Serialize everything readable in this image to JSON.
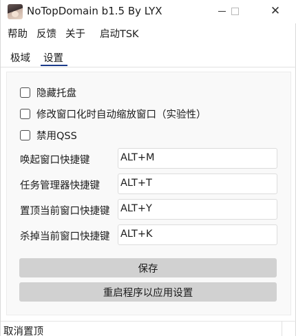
{
  "window": {
    "title": "NoTopDomain b1.5 By LYX",
    "controls": {
      "minimize_icon": "minimize-icon",
      "maximize_icon": "maximize-icon",
      "close_icon": "close-icon",
      "close_glyph": "✕"
    }
  },
  "menubar": {
    "items": [
      {
        "label": "帮助"
      },
      {
        "label": "反馈"
      },
      {
        "label": "关于"
      },
      {
        "label": "启动TSK"
      }
    ]
  },
  "tabs": {
    "items": [
      {
        "label": "极域",
        "active": false
      },
      {
        "label": "设置",
        "active": true
      }
    ],
    "active_color": "#1a3a8a"
  },
  "settings": {
    "checkboxes": [
      {
        "label": "隐藏托盘",
        "checked": false
      },
      {
        "label": "修改窗口化时自动缩放窗口（实验性）",
        "checked": false
      },
      {
        "label": "禁用QSS",
        "checked": false
      }
    ],
    "hotkeys": [
      {
        "label": "唤起窗口快捷键",
        "value": "ALT+M"
      },
      {
        "label": "任务管理器快捷键",
        "value": "ALT+T"
      },
      {
        "label": "置顶当前窗口快捷键",
        "value": "ALT+Y"
      },
      {
        "label": "杀掉当前窗口快捷键",
        "value": "ALT+K"
      }
    ],
    "save_label": "保存",
    "restart_label": "重启程序以应用设置"
  },
  "statusbar": {
    "text": "取消置顶"
  },
  "colors": {
    "button_bg": "#d1d1d1",
    "panel_bg": "#f9f9f9",
    "tab_underline": "#1a3a8a"
  }
}
